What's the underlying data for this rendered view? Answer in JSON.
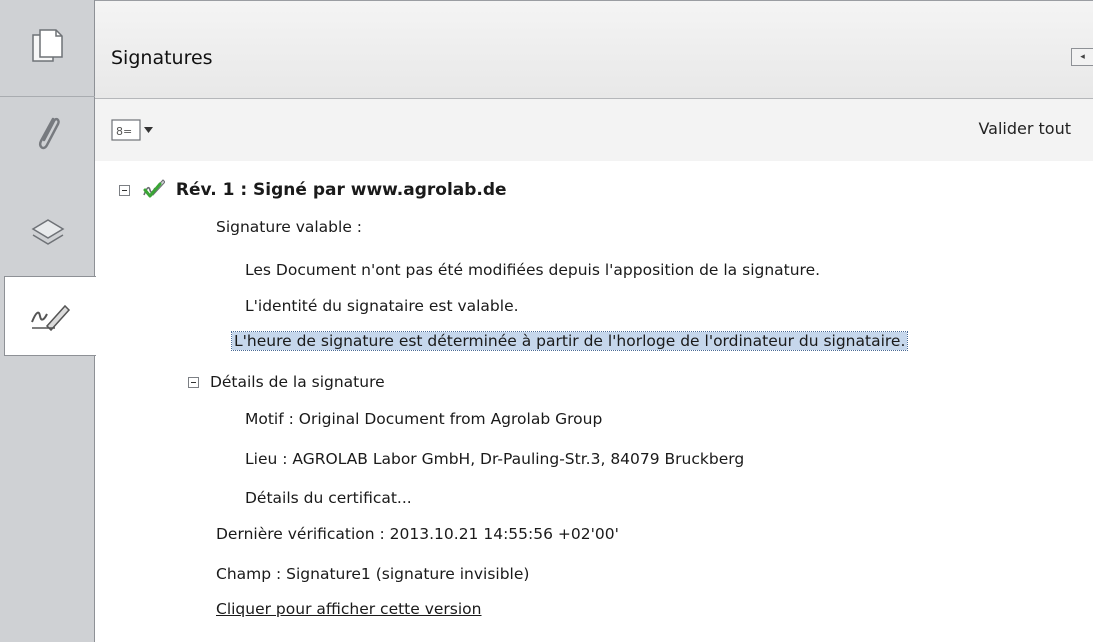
{
  "panel": {
    "title": "Signatures",
    "validate_all_label": "Valider tout"
  },
  "nav": {
    "icons": [
      "pages-icon",
      "attachment-icon",
      "layers-icon",
      "signatures-icon"
    ],
    "active": "signatures-icon"
  },
  "revision": {
    "title": "Rév. 1 : Signé par www.agrolab.de",
    "status_label": "Signature valable :",
    "status_lines": [
      "Les Document n'ont pas été modifiées depuis l'apposition de la signature.",
      "L'identité du signataire est valable.",
      "L'heure de signature est déterminée à partir de l'horloge de l'ordinateur du signataire."
    ],
    "details": {
      "label": "Détails de la signature",
      "motif": "Motif : Original Document from Agrolab Group",
      "lieu": "Lieu : AGROLAB Labor GmbH, Dr-Pauling-Str.3, 84079 Bruckberg",
      "certificate": "Détails du certificat..."
    },
    "last_check": "Dernière vérification : 2013.10.21 14:55:56 +02'00'",
    "field": "Champ : Signature1 (signature invisible)",
    "view_version_link": "Cliquer pour afficher cette version"
  },
  "colors": {
    "nav_background": "#cfd1d4",
    "selection_highlight": "#c6d7ec",
    "valid_check": "#3aa535"
  }
}
